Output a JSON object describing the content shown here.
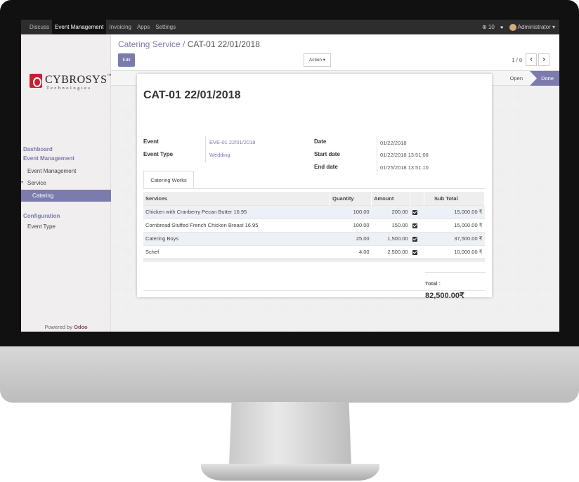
{
  "topnav": {
    "items": [
      "Discuss",
      "Event Management",
      "Invoicing",
      "Apps",
      "Settings"
    ],
    "active": "Event Management",
    "messages": "10",
    "user": "Administrator"
  },
  "sidebar": {
    "logo_name": "CYBROSYS",
    "logo_tm": "™",
    "logo_sub": "Technologies",
    "menu": {
      "dashboard": "Dashboard",
      "event_management": "Event Management",
      "event_management_item": "Event Management",
      "service": "Service",
      "catering": "Catering",
      "configuration": "Configuration",
      "event_type": "Event Type"
    },
    "powered_by": "Powered by",
    "powered_brand": "Odoo"
  },
  "control": {
    "breadcrumb_parent": "Catering Service /",
    "breadcrumb_current": "CAT-01 22/01/2018",
    "edit_label": "Edit",
    "action_label": "Action ▾",
    "pager": "1 / 8",
    "prev": "‹",
    "next": "›"
  },
  "status": {
    "stages": [
      "Open",
      "Done"
    ],
    "current": "Done"
  },
  "record": {
    "title": "CAT-01 22/01/2018",
    "event_label": "Event",
    "event_value": "EVE-01 22/01/2018",
    "event_type_label": "Event Type",
    "event_type_value": "Wedding",
    "date_label": "Date",
    "date_value": "01/22/2018",
    "start_label": "Start date",
    "start_value": "01/22/2018 13:51:06",
    "end_label": "End date",
    "end_value": "01/25/2018 13:51:10"
  },
  "tab": {
    "label": "Catering Works"
  },
  "table": {
    "headers": [
      "Services",
      "Quantity",
      "Amount",
      "",
      "Sub Total"
    ],
    "rows": [
      [
        "Chicken with Cranberry Pecan Butter 16.95",
        "100.00",
        "200.00",
        "15,000.00 ₹"
      ],
      [
        "Cornbread Stuffed French Chicken Breast 16.95",
        "100.00",
        "150.00",
        "15,000.00 ₹"
      ],
      [
        "Catering Boys",
        "25.00",
        "1,500.00",
        "37,500.00 ₹"
      ],
      [
        "Schef",
        "4.00",
        "2,500.00",
        "10,000.00 ₹"
      ]
    ]
  },
  "total": {
    "label": "Total :",
    "value": "82,500.00₹"
  },
  "colors": {
    "accent": "#7c7bad",
    "navbar": "#2d2d2d",
    "odoo": "#8f3f71"
  }
}
